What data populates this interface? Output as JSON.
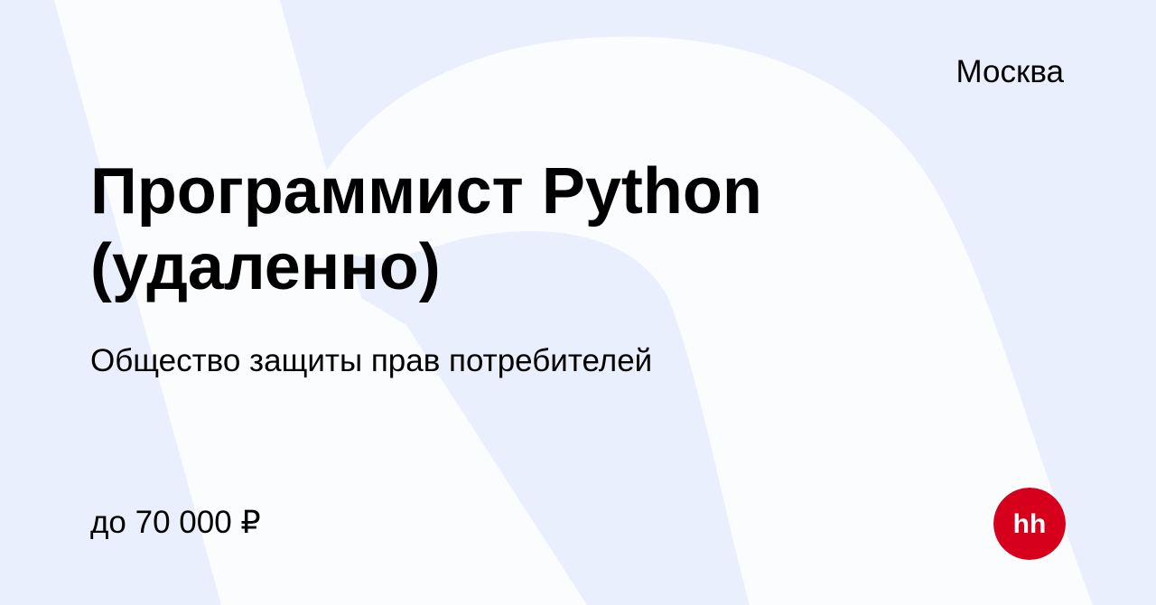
{
  "vacancy": {
    "city": "Москва",
    "title": "Программист Python (удаленно)",
    "company": "Общество защиты прав потребителей",
    "salary": "до 70 000 ₽"
  },
  "logo": {
    "icon": "hh-logo-icon",
    "text": "hh",
    "color": "#d6001c"
  },
  "colors": {
    "background": "#e9effc",
    "shape": "#fbfcfd",
    "text": "#000000"
  }
}
